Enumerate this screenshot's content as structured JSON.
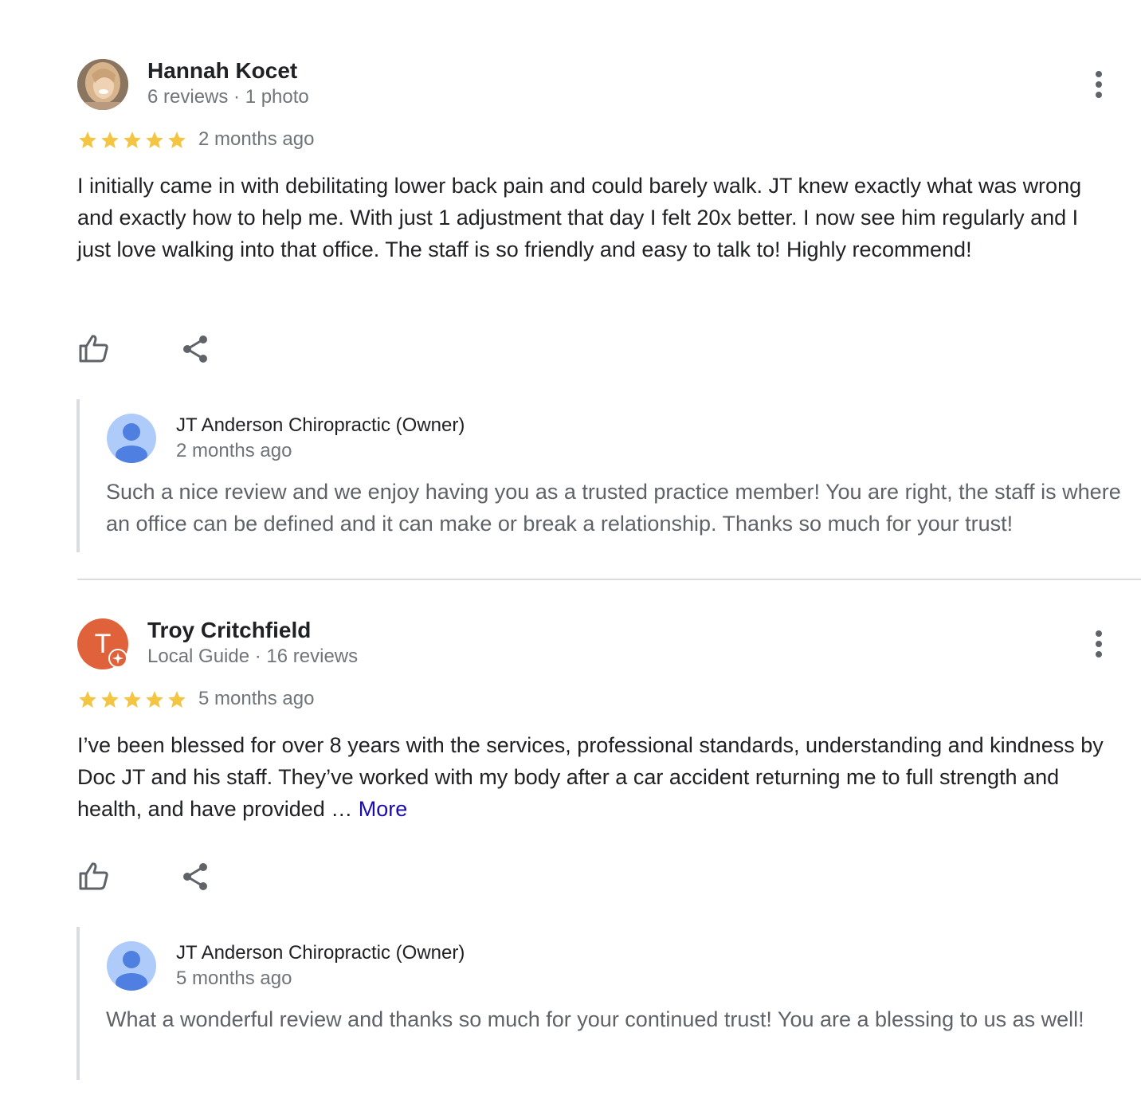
{
  "colors": {
    "star": "#f4c542",
    "link": "#1a0dab",
    "meta_text": "#70757a",
    "owner_avatar_bg": "#aecbfa",
    "owner_avatar_fg": "#4f80e1",
    "letter_avatar_bg": "#e0623a"
  },
  "reviews": [
    {
      "reviewer_name": "Hannah Kocet",
      "reviewer_meta": "6 reviews · 1 photo",
      "avatar_type": "photo",
      "rating": 5,
      "time_ago": "2 months ago",
      "text": "I initially came in with debilitating lower back pain and could barely walk. JT knew exactly what was wrong and exactly how to help me. With just 1 adjustment that day I felt 20x better. I now see him regularly and I just love walking into that office. The staff is so friendly and easy to talk to! Highly recommend!",
      "owner_response": {
        "name": "JT Anderson Chiropractic (Owner)",
        "time_ago": "2 months ago",
        "text": "Such a nice review and we enjoy having you as a trusted practice member! You are right, the staff is where an office can be defined and it can make or break a relationship. Thanks so much for your trust!"
      }
    },
    {
      "reviewer_name": "Troy Critchfield",
      "reviewer_meta": "Local Guide · 16 reviews",
      "avatar_type": "letter",
      "avatar_letter": "T",
      "rating": 5,
      "time_ago": "5 months ago",
      "text": "I’ve been blessed for over 8 years with the services, professional standards, understanding and kindness by Doc JT and his staff. They’ve worked with my body after a car accident returning me to full strength and health, and have provided … ",
      "more_label": "More",
      "owner_response": {
        "name": "JT Anderson Chiropractic (Owner)",
        "time_ago": "5 months ago",
        "text": "What a wonderful review and thanks so much for your continued trust! You are a blessing to us as well!"
      }
    }
  ]
}
